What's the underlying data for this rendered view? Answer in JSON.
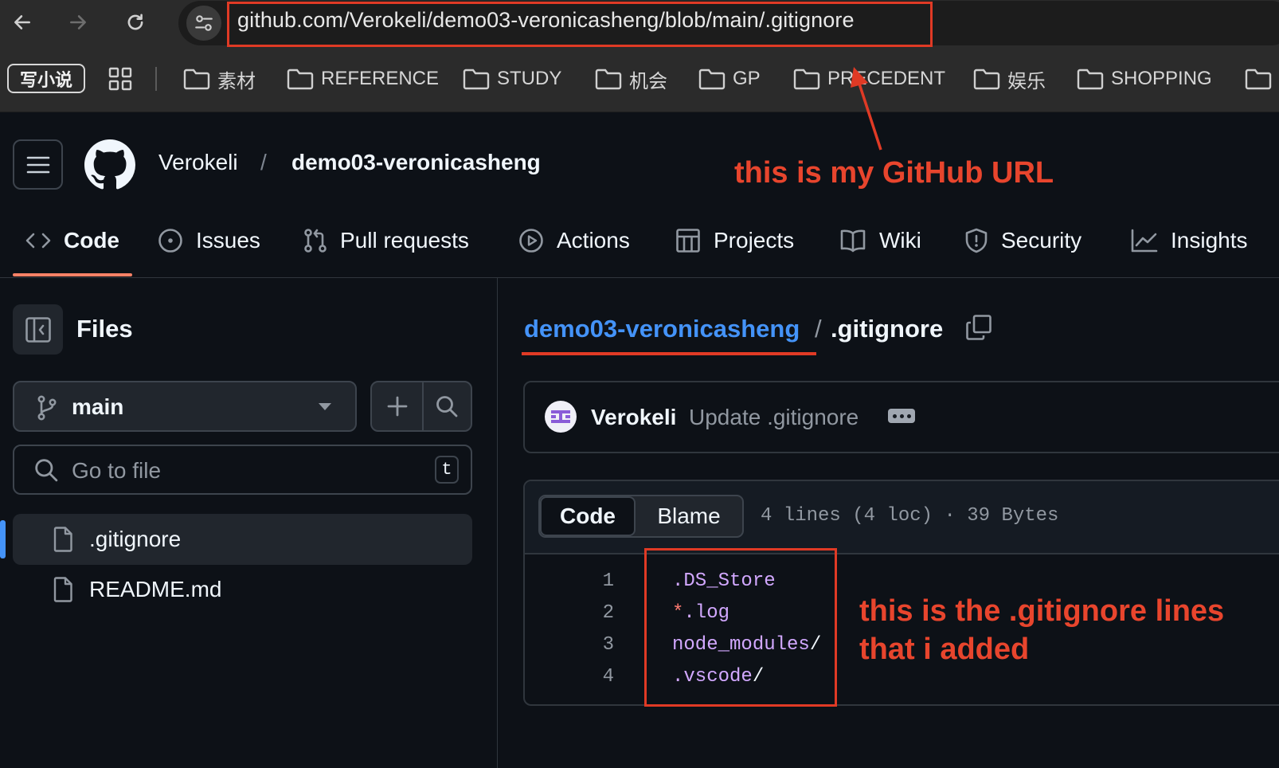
{
  "browser": {
    "url": "github.com/Verokeli/demo03-veronicasheng/blob/main/.gitignore",
    "bookmark_app": "写小说",
    "bookmarks": [
      "素材",
      "REFERENCE",
      "STUDY",
      "机会",
      "GP",
      "PRECEDENT",
      "娱乐",
      "SHOPPING"
    ]
  },
  "header": {
    "owner": "Verokeli",
    "separator": "/",
    "repo": "demo03-veronicasheng"
  },
  "tabs": [
    "Code",
    "Issues",
    "Pull requests",
    "Actions",
    "Projects",
    "Wiki",
    "Security",
    "Insights"
  ],
  "active_tab": "Code",
  "sidebar": {
    "title": "Files",
    "branch": "main",
    "goto_placeholder": "Go to file",
    "goto_shortcut": "t",
    "files": [
      ".gitignore",
      "README.md"
    ],
    "active_file": ".gitignore"
  },
  "breadcrumb": {
    "repo": "demo03-veronicasheng",
    "separator": "/",
    "file": ".gitignore"
  },
  "commit": {
    "author": "Verokeli",
    "message": "Update .gitignore"
  },
  "code_view": {
    "mode_code": "Code",
    "mode_blame": "Blame",
    "meta": "4 lines (4 loc) · 39 Bytes",
    "line_numbers": [
      "1",
      "2",
      "3",
      "4"
    ],
    "lines": [
      {
        "main": ".DS_Store",
        "trail": ""
      },
      {
        "star": "*",
        "main": ".log",
        "trail": ""
      },
      {
        "main": "node_modules",
        "trail": "/"
      },
      {
        "main": ".vscode",
        "trail": "/"
      }
    ]
  },
  "annotations": {
    "url_note": "this is my GitHub URL",
    "lines_note_1": "this is the .gitignore lines",
    "lines_note_2": "that i added"
  },
  "colors": {
    "annotation": "#e8452d",
    "link": "#4493f8",
    "tab_underline": "#f78166",
    "code_token": "#d2a8ff"
  }
}
